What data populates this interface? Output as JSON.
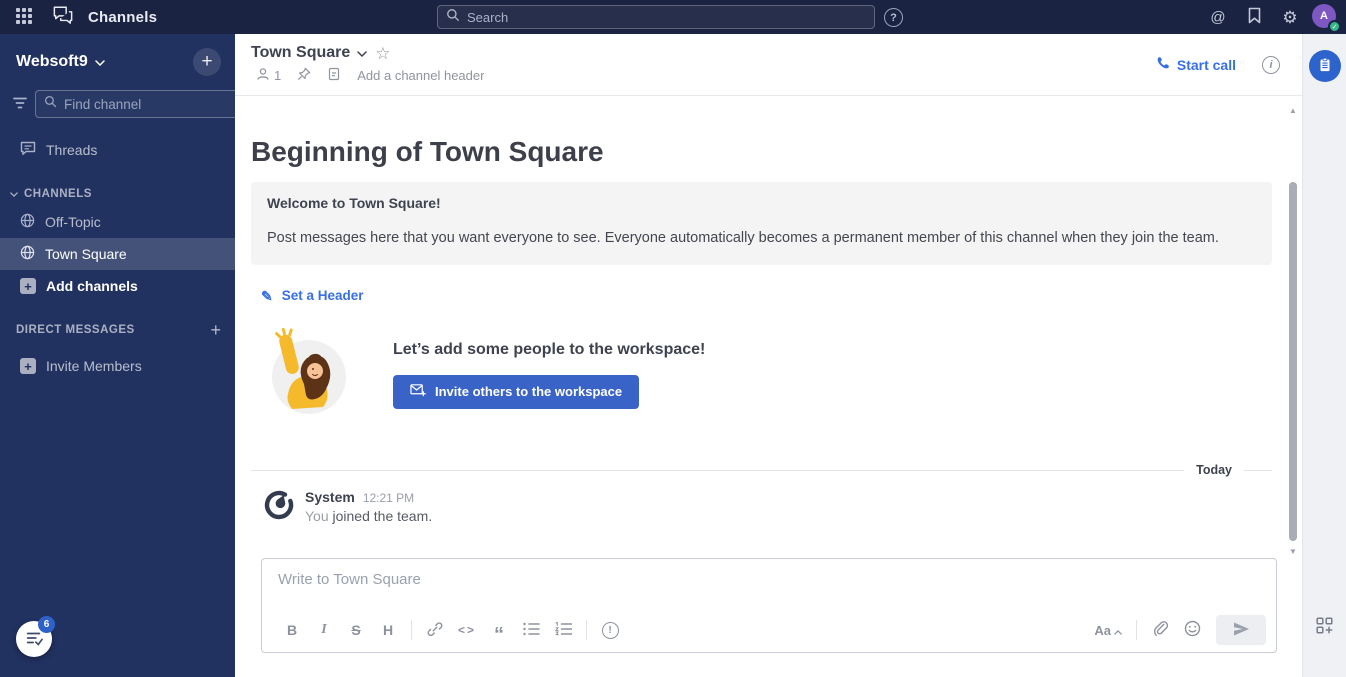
{
  "topbar": {
    "app_title": "Channels",
    "search_placeholder": "Search"
  },
  "sidebar": {
    "workspace_name": "Websoft9",
    "find_channel_placeholder": "Find channel",
    "threads_label": "Threads",
    "channels_section_label": "CHANNELS",
    "channels": [
      {
        "label": "Off-Topic"
      },
      {
        "label": "Town Square"
      }
    ],
    "add_channels_label": "Add channels",
    "direct_messages_section_label": "DIRECT MESSAGES",
    "invite_members_label": "Invite Members",
    "tasks_badge_count": "6"
  },
  "channel_header": {
    "title": "Town Square",
    "member_count": "1",
    "add_channel_header_label": "Add a channel header",
    "start_call_label": "Start call"
  },
  "content": {
    "intro_heading": "Beginning of Town Square",
    "welcome_title": "Welcome to Town Square!",
    "welcome_body": "Post messages here that you want everyone to see. Everyone automatically becomes a permanent member of this channel when they join the team.",
    "set_header_label": "Set a Header",
    "invite_heading": "Let’s add some people to the workspace!",
    "invite_button_label": "Invite others to the workspace",
    "date_divider_label": "Today",
    "system_post": {
      "author": "System",
      "timestamp": "12:21 PM",
      "prefix": "You ",
      "message": "joined the team."
    }
  },
  "composer": {
    "placeholder": "Write to Town Square"
  },
  "glyphs": {
    "bold": "B",
    "italic": "I",
    "strikethrough": "S",
    "heading": "H",
    "code": "<>",
    "quote": "“",
    "priority": "!",
    "at_mention": "@",
    "help": "?",
    "info": "i",
    "format": "Aa",
    "plus": "+",
    "star": "☆",
    "pencil": "✎",
    "gear": "⚙",
    "check": "✓",
    "avatar_initial": "A",
    "scroll_up": "▲",
    "scroll_down": "▼"
  },
  "colors": {
    "topbar_bg": "#1a2342",
    "sidebar_bg": "#213160",
    "sidebar_selected": "#32426d",
    "accent_blue": "#386fe5",
    "button_blue": "#3a63c8",
    "avatar_purple": "#7d57c2",
    "online_green": "#35b887",
    "card_bg": "#f4f4f5",
    "appbar_bg": "#f0f1f4"
  }
}
